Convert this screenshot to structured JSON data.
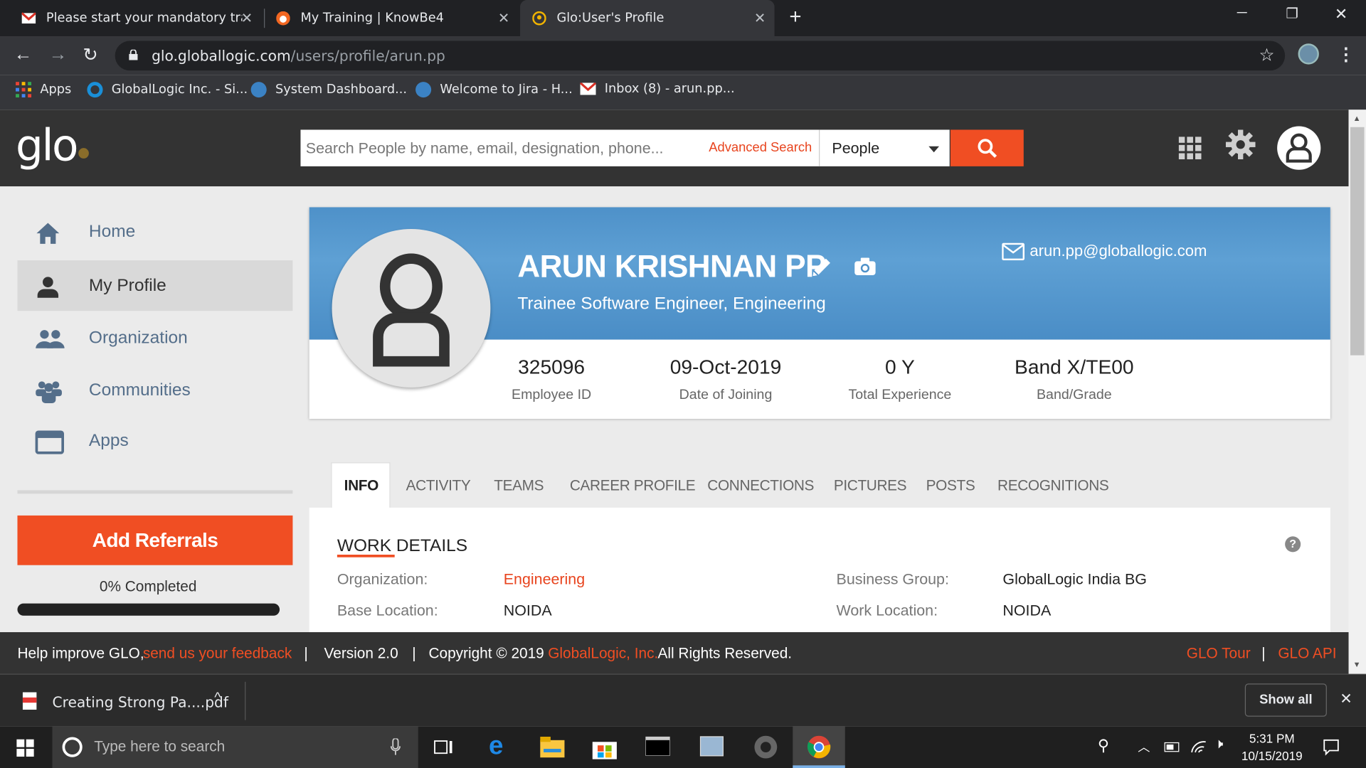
{
  "browser": {
    "tabs": [
      {
        "title": "Please start your mandatory trair"
      },
      {
        "title": "My Training | KnowBe4"
      },
      {
        "title": "Glo:User's Profile"
      }
    ],
    "url_host": "glo.globallogic.com",
    "url_path": "/users/profile/arun.pp",
    "bookmarks": [
      {
        "label": "Apps"
      },
      {
        "label": "GlobalLogic Inc. - Si..."
      },
      {
        "label": "System Dashboard..."
      },
      {
        "label": "Welcome to Jira - H..."
      },
      {
        "label": "Inbox (8) - arun.pp..."
      }
    ]
  },
  "header": {
    "logo": "glo",
    "search_placeholder": "Search People by name, email, designation, phone...",
    "advanced_search": "Advanced Search",
    "search_scope": "People"
  },
  "sidebar": {
    "items": [
      {
        "label": "Home",
        "icon": "home-icon"
      },
      {
        "label": "My Profile",
        "icon": "person-icon"
      },
      {
        "label": "Organization",
        "icon": "organization-icon"
      },
      {
        "label": "Communities",
        "icon": "communities-icon"
      },
      {
        "label": "Apps",
        "icon": "apps-window-icon"
      }
    ],
    "add_referrals": "Add Referrals",
    "completion_text": "0% Completed",
    "completion_value": 0
  },
  "profile": {
    "name": "ARUN KRISHNAN PP",
    "designation": "Trainee Software Engineer, Engineering",
    "email": "arun.pp@globallogic.com",
    "stats": [
      {
        "value": "325096",
        "label": "Employee ID"
      },
      {
        "value": "09-Oct-2019",
        "label": "Date of Joining"
      },
      {
        "value": "0 Y",
        "label": "Total Experience"
      },
      {
        "value": "Band X/TE00",
        "label": "Band/Grade"
      }
    ]
  },
  "profile_tabs": [
    "INFO",
    "ACTIVITY",
    "TEAMS",
    "CAREER PROFILE",
    "CONNECTIONS",
    "PICTURES",
    "POSTS",
    "RECOGNITIONS"
  ],
  "work_details": {
    "title": "WORK DETAILS",
    "fields": [
      {
        "label": "Organization:",
        "value": "Engineering"
      },
      {
        "label": "Business Group:",
        "value": "GlobalLogic India BG"
      },
      {
        "label": "Base Location:",
        "value": "NOIDA"
      },
      {
        "label": "Work Location:",
        "value": "NOIDA"
      }
    ]
  },
  "footer": {
    "help_text": "Help improve GLO,",
    "feedback_link": "send us your feedback",
    "version": "Version 2.0",
    "copyright_prefix": "Copyright © 2019",
    "company_link": "GlobalLogic, Inc.",
    "copyright_suffix": "All Rights Reserved.",
    "glo_tour": "GLO Tour",
    "glo_api": "GLO API"
  },
  "downloads": {
    "file": "Creating Strong Pa....pdf",
    "show_all": "Show all"
  },
  "taskbar": {
    "search_placeholder": "Type here to search",
    "time": "5:31 PM",
    "date": "10/15/2019"
  },
  "colors": {
    "accent": "#f04e23",
    "banner": "#4e91c9",
    "header": "#333333"
  }
}
